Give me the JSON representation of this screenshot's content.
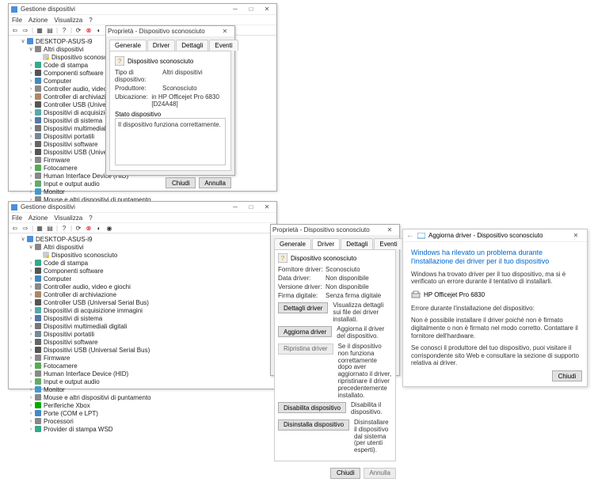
{
  "devmgr": {
    "title": "Gestione dispositivi",
    "menu": [
      "File",
      "Azione",
      "Visualizza",
      "?"
    ],
    "root": "DESKTOP-ASUS-i9",
    "cat_altri": "Altri dispositivi",
    "unknown_dev": "Dispositivo sconosciuto",
    "categories": [
      "Code di stampa",
      "Componenti software",
      "Computer",
      "Controller audio, video e giochi",
      "Controller di archiviazione",
      "Controller USB (Universal Serial Bus)",
      "Dispositivi di acquisizione immagini",
      "Dispositivi di sistema",
      "Dispositivi multimediali digitali",
      "Dispositivi portatili",
      "Dispositivi software",
      "Dispositivi USB (Universal Serial Bus)",
      "Firmware",
      "Fotocamere",
      "Human Interface Device (HID)",
      "Input e output audio",
      "Monitor",
      "Mouse e altri dispositivi di puntamento",
      "Periferiche Xbox",
      "Porte (COM e LPT)",
      "Processori",
      "Provider di stampa WSD"
    ]
  },
  "icons": {
    "printer": "#3a8",
    "soft": "#555",
    "pc": "#48b",
    "audio": "#888",
    "storage": "#a86",
    "usb": "#555",
    "imaging": "#5aa",
    "system": "#57a",
    "media": "#777",
    "portable": "#789",
    "softdev": "#666",
    "firmware": "#888",
    "camera": "#5a5",
    "hid": "#888",
    "sound": "#6a6",
    "monitor": "#49c",
    "mouse": "#888",
    "xbox": "#0a0",
    "ports": "#48c",
    "cpu": "#888",
    "wsd": "#3a8"
  },
  "props1": {
    "title": "Proprietà - Dispositivo sconosciuto",
    "tabs": [
      "Generale",
      "Driver",
      "Dettagli",
      "Eventi"
    ],
    "dev_label": "Dispositivo sconosciuto",
    "rows": {
      "k_type": "Tipo di dispositivo:",
      "v_type": "Altri dispositivi",
      "k_mfr": "Produttore:",
      "v_mfr": "Sconosciuto",
      "k_loc": "Ubicazione:",
      "v_loc": "in HP Officejet Pro 6830 [D24A48]"
    },
    "status_label": "Stato dispositivo",
    "status_text": "Il dispositivo funziona correttamente.",
    "btn_close": "Chiudi",
    "btn_cancel": "Annulla"
  },
  "props2": {
    "title": "Proprietà - Dispositivo sconosciuto",
    "tabs": [
      "Generale",
      "Driver",
      "Dettagli",
      "Eventi"
    ],
    "dev_label": "Dispositivo sconosciuto",
    "rows": {
      "k_prov": "Fornitore driver:",
      "v_prov": "Sconosciuto",
      "k_date": "Data driver:",
      "v_date": "Non disponibile",
      "k_ver": "Versione driver:",
      "v_ver": "Non disponibile",
      "k_sig": "Firma digitale:",
      "v_sig": "Senza firma digitale"
    },
    "actions": [
      {
        "btn": "Dettagli driver",
        "desc": "Visualizza dettagli sui file dei driver installati."
      },
      {
        "btn": "Aggiorna driver",
        "desc": "Aggiorna il driver del dispositivo."
      },
      {
        "btn": "Ripristina driver",
        "desc": "Se il dispositivo non funziona correttamente dopo aver aggiornato il driver, ripristinare il driver precedentemente installato."
      },
      {
        "btn": "Disabilita dispositivo",
        "desc": "Disabilita il dispositivo."
      },
      {
        "btn": "Disinstalla dispositivo",
        "desc": "Disinstallare il dispositivo dal sistema (per utenti esperti)."
      }
    ],
    "btn_close": "Chiudi",
    "btn_cancel": "Annulla"
  },
  "wizard": {
    "title": "Aggiorna driver - Dispositivo sconosciuto",
    "headline": "Windows ha rilevato un problema durante l'installazione dei driver per il tuo dispositivo",
    "p1": "Windows ha trovato driver per il tuo dispositivo, ma si è verificato un errore durante il tentativo di installarli.",
    "dev": "HP Officejet Pro 6830",
    "p2": "Errore durante l'installazione del dispositivo:",
    "p3": "Non è possibile installare il driver poiché non è firmato digitalmente o non è firmato nel modo corretto. Contattare il fornitore dell'hardware.",
    "p4": "Se conosci il produttore del tuo dispositivo, puoi visitare il corrispondente sito Web e consultare la sezione di supporto relativa ai driver.",
    "btn_close": "Chiudi"
  }
}
